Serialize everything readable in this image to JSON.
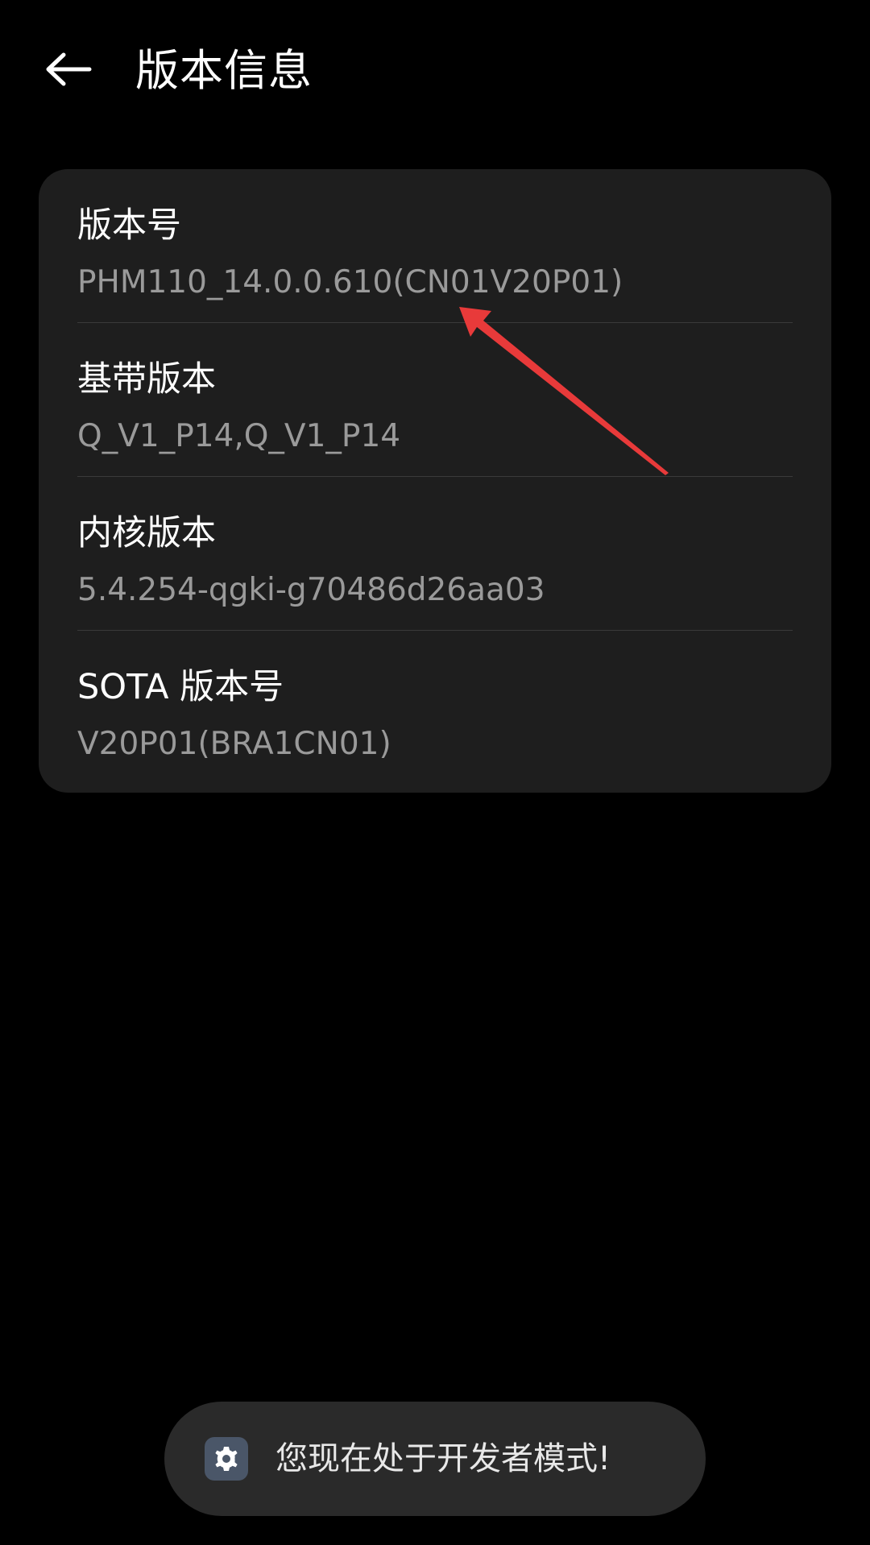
{
  "header": {
    "title": "版本信息",
    "back_icon": "arrow-left-icon"
  },
  "version_info": {
    "items": [
      {
        "label": "版本号",
        "value": "PHM110_14.0.0.610(CN01V20P01)"
      },
      {
        "label": "基带版本",
        "value": "Q_V1_P14,Q_V1_P14"
      },
      {
        "label": "内核版本",
        "value": "5.4.254-qgki-g70486d26aa03"
      },
      {
        "label": "SOTA 版本号",
        "value": "V20P01(BRA1CN01)"
      }
    ]
  },
  "toast": {
    "icon": "settings-gear-icon",
    "text": "您现在处于开发者模式!"
  },
  "colors": {
    "background": "#000000",
    "card": "#1e1e1e",
    "value_text": "#9a9a9a",
    "annotation_arrow": "#e83a3a",
    "toast_bg": "#2a2a2a"
  }
}
